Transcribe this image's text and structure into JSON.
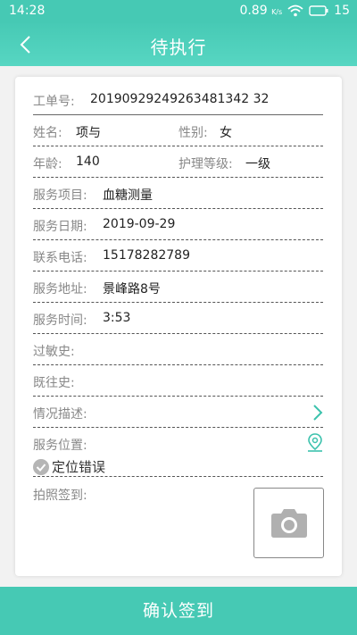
{
  "status": {
    "time": "14:28",
    "speed": "0.89",
    "speed_unit": "K/s",
    "battery": "15"
  },
  "header": {
    "title": "待执行"
  },
  "form": {
    "order_label": "工单号:",
    "order_value": "20190929249263481342 32",
    "name_label": "姓名:",
    "name_value": "项与",
    "gender_label": "性别:",
    "gender_value": "女",
    "age_label": "年龄:",
    "age_value": "140",
    "care_label": "护理等级:",
    "care_value": "一级",
    "service_item_label": "服务项目:",
    "service_item_value": "血糖测量",
    "service_date_label": "服务日期:",
    "service_date_value": "2019-09-29",
    "phone_label": "联系电话:",
    "phone_value": "15178282789",
    "address_label": "服务地址:",
    "address_value": "景峰路8号",
    "service_time_label": "服务时间:",
    "service_time_value": "3:53",
    "allergy_label": "过敏史:",
    "history_label": "既往史:",
    "situation_label": "情况描述:",
    "location_label": "服务位置:",
    "location_error": "定位错误",
    "photo_label": "拍照签到:"
  },
  "action": {
    "confirm_label": "确认签到"
  }
}
